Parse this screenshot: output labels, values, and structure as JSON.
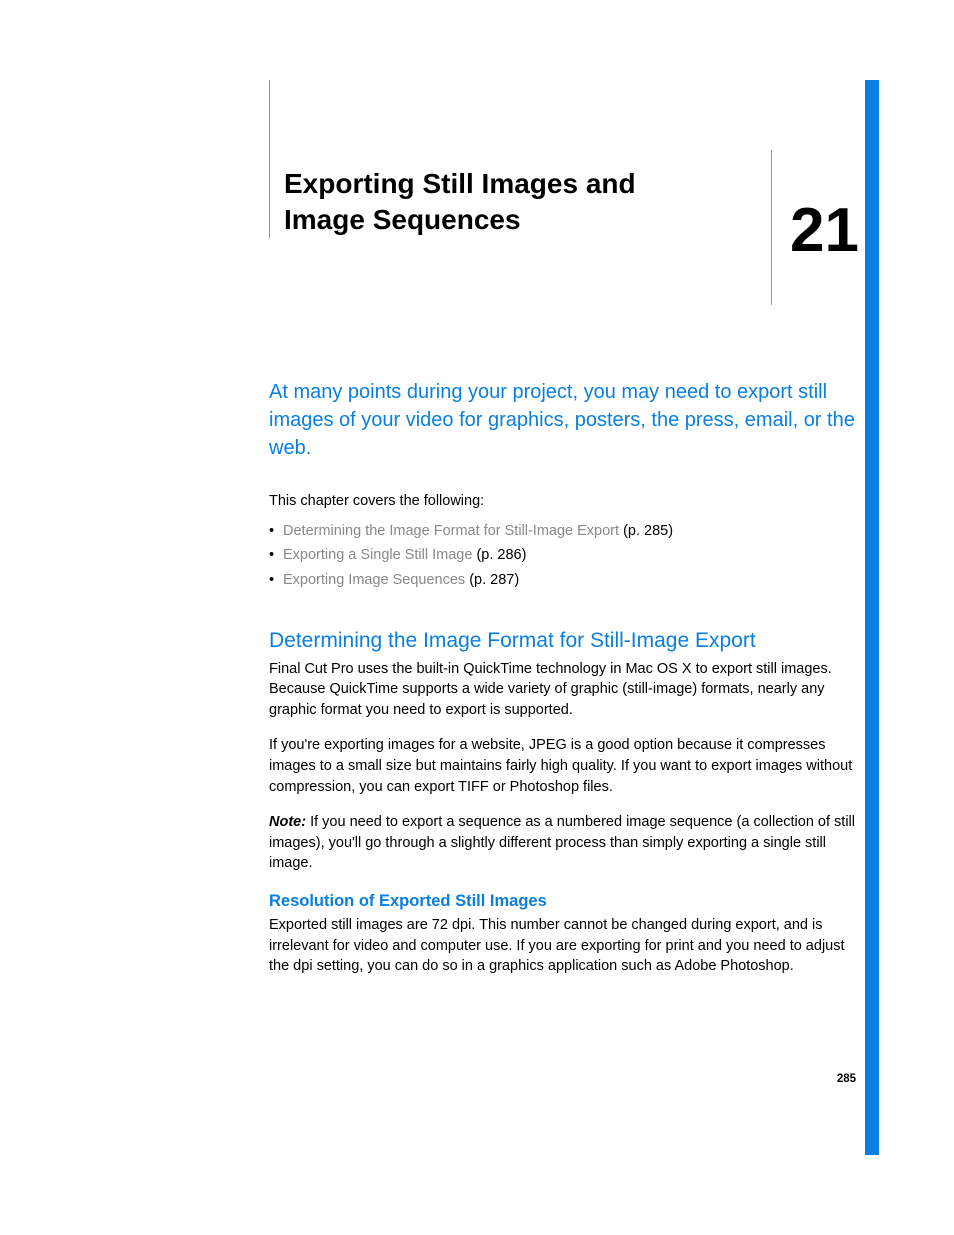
{
  "chapter": {
    "title": "Exporting Still Images and Image Sequences",
    "number": "21"
  },
  "intro": "At many points during your project, you may need to export still images of your video for graphics, posters, the press, email, or the web.",
  "covers_label": "This chapter covers the following:",
  "toc": [
    {
      "label": "Determining the Image Format for Still-Image Export",
      "page": "(p. 285)"
    },
    {
      "label": "Exporting a Single Still Image",
      "page": "(p. 286)"
    },
    {
      "label": "Exporting Image Sequences",
      "page": "(p. 287)"
    }
  ],
  "section1": {
    "heading": "Determining the Image Format for Still-Image Export",
    "p1": "Final Cut Pro uses the built-in QuickTime technology in Mac OS X to export still images. Because QuickTime supports a wide variety of graphic (still-image) formats, nearly any graphic format you need to export is supported.",
    "p2": "If you're exporting images for a website, JPEG is a good option because it compresses images to a small size but maintains fairly high quality. If you want to export images without compression, you can export TIFF or Photoshop files.",
    "note_label": "Note:  ",
    "note_body": "If you need to export a sequence as a numbered image sequence (a collection of still images), you'll go through a slightly different process than simply exporting a single still image.",
    "sub_heading": "Resolution of Exported Still Images",
    "p3": "Exported still images are 72 dpi. This number cannot be changed during export, and is irrelevant for video and computer use. If you are exporting for print and you need to adjust the dpi setting, you can do so in a graphics application such as Adobe Photoshop."
  },
  "page_number": "285"
}
